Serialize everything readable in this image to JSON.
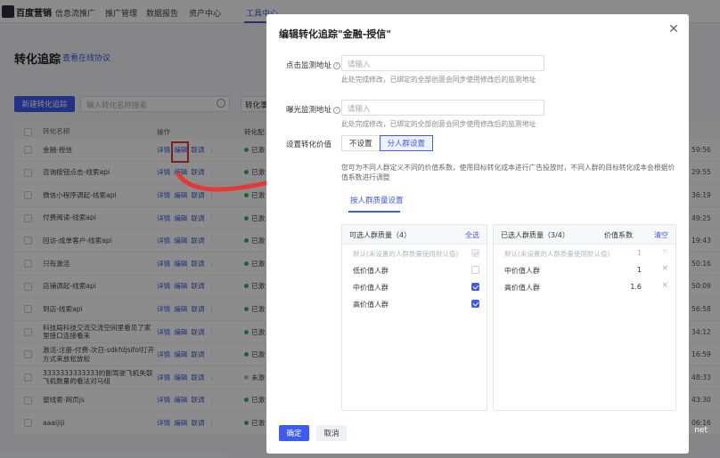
{
  "app": {
    "logo": "百度营销"
  },
  "nav": [
    "信息流推广",
    "推广管理",
    "数据报告",
    "资产中心",
    "工具中心"
  ],
  "page": {
    "title": "转化追踪",
    "help_link": "查看在线协议"
  },
  "toolbar": {
    "new_button": "新建转化追踪",
    "search_placeholder": "输入转化名称搜索",
    "filter_button": "转化事"
  },
  "table": {
    "headers": {
      "name": "转化名称",
      "ops": "操作",
      "status": "转化配"
    },
    "op_labels": [
      "详情",
      "编辑",
      "联调"
    ],
    "rows": [
      {
        "name": "金融-授信",
        "status": "已激",
        "right": "59:56"
      },
      {
        "name": "咨询按钮点击-线索api",
        "status": "已激",
        "right": "29:55"
      },
      {
        "name": "微信小程序调起-线索api",
        "status": "已激",
        "right": "36:19"
      },
      {
        "name": "付费阅读-线索api",
        "status": "已激",
        "right": "49:25"
      },
      {
        "name": "回访-成单客户-线索api",
        "status": "已激",
        "right": "19:43"
      },
      {
        "name": "只有激活",
        "status": "已激",
        "right": "50:16"
      },
      {
        "name": "店铺调起-线索api",
        "status": "已激",
        "right": "50:09"
      },
      {
        "name": "到店-线索api",
        "status": "已激",
        "right": "56:58"
      },
      {
        "name": "科技局科技交流交流空间里看见了家里接口连接看来",
        "status": "已激",
        "right": "34:12"
      },
      {
        "name": "激活-注册-付费-次日-sdkfdjsifol打开方式来放松放松",
        "status": "已激",
        "right": "16:59"
      },
      {
        "name": "3333333333333的副驾驶飞机失联飞机数量的看法对马组",
        "status": "未激",
        "right": "48:33"
      },
      {
        "name": "留线索-网页js",
        "status": "已激",
        "right": "43:30"
      },
      {
        "name": "aaaijiji",
        "status": "已激",
        "right": "06:16"
      }
    ]
  },
  "overlay_tag": "net",
  "modal": {
    "title": "编辑转化追踪\"金融-授信\"",
    "click_url": {
      "label": "点击监测地址",
      "placeholder": "请输入",
      "tip": "此处完成修改，已绑定的全部创意会同步使用修改后的监测地址"
    },
    "expose_url": {
      "label": "曝光监测地址",
      "placeholder": "请输入",
      "tip": "此处完成修改，已绑定的全部创意会同步使用修改后的监测地址"
    },
    "value_setting": {
      "label": "设置转化价值",
      "options": [
        "不设置",
        "分人群设置"
      ],
      "selected": "分人群设置"
    },
    "description": "您可为不同人群定义不同的价值系数，使用目标转化成本进行广告投放时，不同人群的目标转化成本会根据价值系数进行调整",
    "subtab": "按人群质量设置",
    "available": {
      "title": "可选人群质量（4）",
      "select_all": "全选",
      "items": [
        {
          "label": "默认(未设置的人群质量使用默认值)",
          "disabled": true,
          "checked": true
        },
        {
          "label": "低价值人群",
          "disabled": false,
          "checked": false
        },
        {
          "label": "中价值人群",
          "disabled": false,
          "checked": true
        },
        {
          "label": "高价值人群",
          "disabled": false,
          "checked": true
        }
      ]
    },
    "selected": {
      "title": "已选人群质量（3/4）",
      "coef_header": "价值系数",
      "clear": "清空",
      "items": [
        {
          "label": "默认(未设置的人群质量使用默认值)",
          "value": "1",
          "disabled": true
        },
        {
          "label": "中价值人群",
          "value": "1",
          "disabled": false
        },
        {
          "label": "高价值人群",
          "value": "1.6",
          "disabled": false
        }
      ]
    },
    "confirm": "确定",
    "cancel": "取消"
  },
  "colors": {
    "primary": "#3d5af1",
    "highlight": "#e53935"
  }
}
